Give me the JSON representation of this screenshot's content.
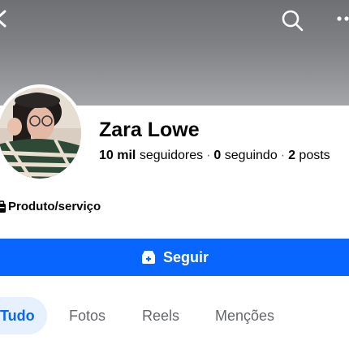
{
  "profile": {
    "name": "Zara Lowe",
    "followers_count": "10 mil",
    "followers_label": "seguidores",
    "following_count": "0",
    "following_label": "seguindo",
    "posts_count": "2",
    "posts_label": "posts",
    "separator": "·",
    "category": "Produto/serviço"
  },
  "actions": {
    "follow_label": "Seguir"
  },
  "tabs": [
    {
      "label": "Tudo",
      "active": true
    },
    {
      "label": "Fotos",
      "active": false
    },
    {
      "label": "Reels",
      "active": false
    },
    {
      "label": "Menções",
      "active": false
    }
  ],
  "icons": {
    "back": "chevron-left-icon",
    "search": "search-icon",
    "more": "more-icon",
    "category": "briefcase-icon",
    "follow": "follow-icon"
  },
  "colors": {
    "accent": "#0866ff",
    "active_tab_bg": "#e7f0fd",
    "text_primary": "#050505",
    "text_secondary": "#65676b"
  }
}
